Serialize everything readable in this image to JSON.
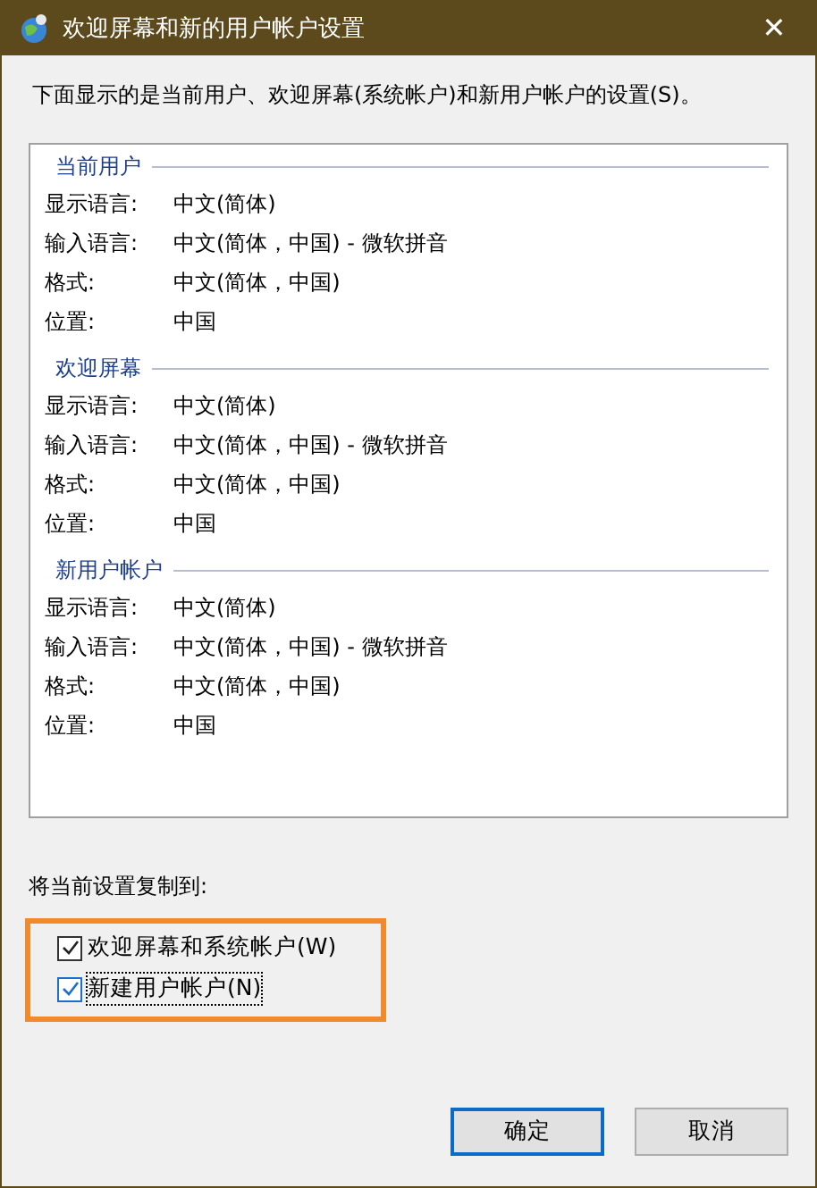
{
  "window": {
    "title": "欢迎屏幕和新的用户帐户设置",
    "close": "✕"
  },
  "intro": "下面显示的是当前用户、欢迎屏幕(系统帐户)和新用户帐户的设置(S)。",
  "sections": [
    {
      "title": "当前用户",
      "rows": [
        {
          "label": "显示语言:",
          "value": "中文(简体)"
        },
        {
          "label": "输入语言:",
          "value": "中文(简体，中国) - 微软拼音"
        },
        {
          "label": "格式:",
          "value": "中文(简体，中国)"
        },
        {
          "label": "位置:",
          "value": "中国"
        }
      ]
    },
    {
      "title": "欢迎屏幕",
      "rows": [
        {
          "label": "显示语言:",
          "value": "中文(简体)"
        },
        {
          "label": "输入语言:",
          "value": "中文(简体，中国) - 微软拼音"
        },
        {
          "label": "格式:",
          "value": "中文(简体，中国)"
        },
        {
          "label": "位置:",
          "value": "中国"
        }
      ]
    },
    {
      "title": "新用户帐户",
      "rows": [
        {
          "label": "显示语言:",
          "value": "中文(简体)"
        },
        {
          "label": "输入语言:",
          "value": "中文(简体，中国) - 微软拼音"
        },
        {
          "label": "格式:",
          "value": "中文(简体，中国)"
        },
        {
          "label": "位置:",
          "value": "中国"
        }
      ]
    }
  ],
  "copy_label": "将当前设置复制到:",
  "checkboxes": [
    {
      "label": "欢迎屏幕和系统帐户(W)",
      "checked": true,
      "focused": false
    },
    {
      "label": "新建用户帐户(N)",
      "checked": true,
      "focused": true
    }
  ],
  "buttons": [
    {
      "label": "确定",
      "default": true
    },
    {
      "label": "取消",
      "default": false
    }
  ]
}
